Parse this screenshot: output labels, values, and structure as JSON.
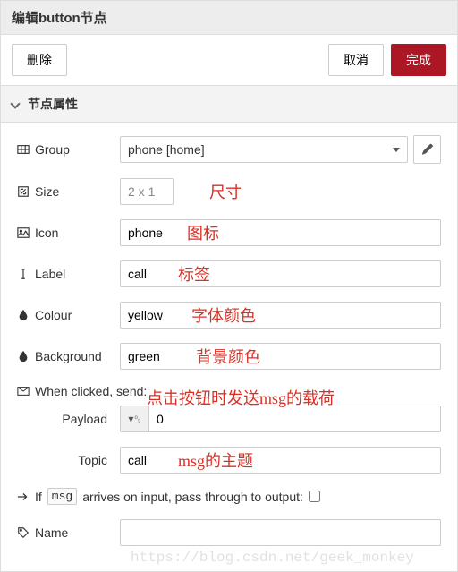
{
  "header": {
    "title": "编辑button节点"
  },
  "actions": {
    "delete": "删除",
    "cancel": "取消",
    "done": "完成"
  },
  "section": {
    "title": "节点属性"
  },
  "form": {
    "group": {
      "label": "Group",
      "value": "phone [home]"
    },
    "size": {
      "label": "Size",
      "value": "2 x 1"
    },
    "icon": {
      "label": "Icon",
      "value": "phone"
    },
    "labelField": {
      "label": "Label",
      "value": "call"
    },
    "colour": {
      "label": "Colour",
      "value": "yellow"
    },
    "background": {
      "label": "Background",
      "value": "green"
    },
    "whenClicked": {
      "label": "When clicked, send:"
    },
    "payload": {
      "label": "Payload",
      "value": "0"
    },
    "topic": {
      "label": "Topic",
      "value": "call"
    },
    "passthrough": {
      "prefix": "If",
      "code": "msg",
      "suffix": "arrives on input, pass through to output:"
    },
    "name": {
      "label": "Name",
      "value": ""
    }
  },
  "annotations": {
    "size": "尺寸",
    "icon": "图标",
    "label": "标签",
    "colour": "字体颜色",
    "background": "背景颜色",
    "payload": "点击按钮时发送msg的载荷",
    "topic": "msg的主题"
  },
  "watermark": "https://blog.csdn.net/geek_monkey"
}
